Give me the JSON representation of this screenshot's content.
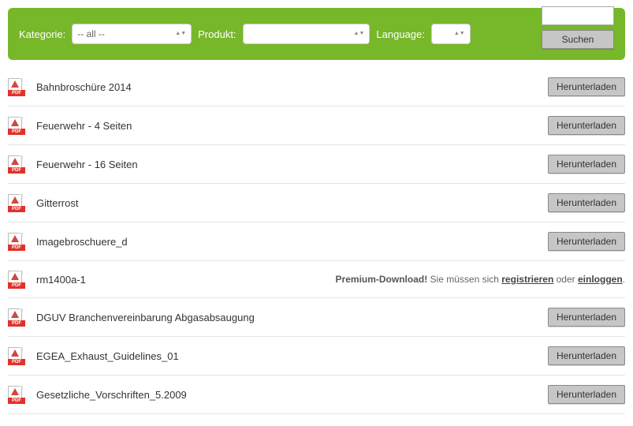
{
  "filters": {
    "category_label": "Kategorie:",
    "category_value": "-- all --",
    "product_label": "Produkt:",
    "product_value": "",
    "language_label": "Language:",
    "language_value": "",
    "search_button": "Suchen"
  },
  "download_label": "Herunterladen",
  "premium": {
    "bold": "Premium-Download!",
    "middle": " Sie müssen sich ",
    "register": "registrieren",
    "or": " oder ",
    "login": "einloggen",
    "end": "."
  },
  "items": {
    "0": {
      "title": "Bahnbroschüre 2014",
      "premium": false
    },
    "1": {
      "title": "Feuerwehr - 4 Seiten",
      "premium": false
    },
    "2": {
      "title": "Feuerwehr - 16 Seiten",
      "premium": false
    },
    "3": {
      "title": "Gitterrost",
      "premium": false
    },
    "4": {
      "title": "Imagebroschuere_d",
      "premium": false
    },
    "5": {
      "title": "rm1400a-1",
      "premium": true
    },
    "6": {
      "title": "DGUV Branchenvereinbarung Abgasabsaugung",
      "premium": false
    },
    "7": {
      "title": "EGEA_Exhaust_Guidelines_01",
      "premium": false
    },
    "8": {
      "title": "Gesetzliche_Vorschriften_5.2009",
      "premium": false
    }
  }
}
